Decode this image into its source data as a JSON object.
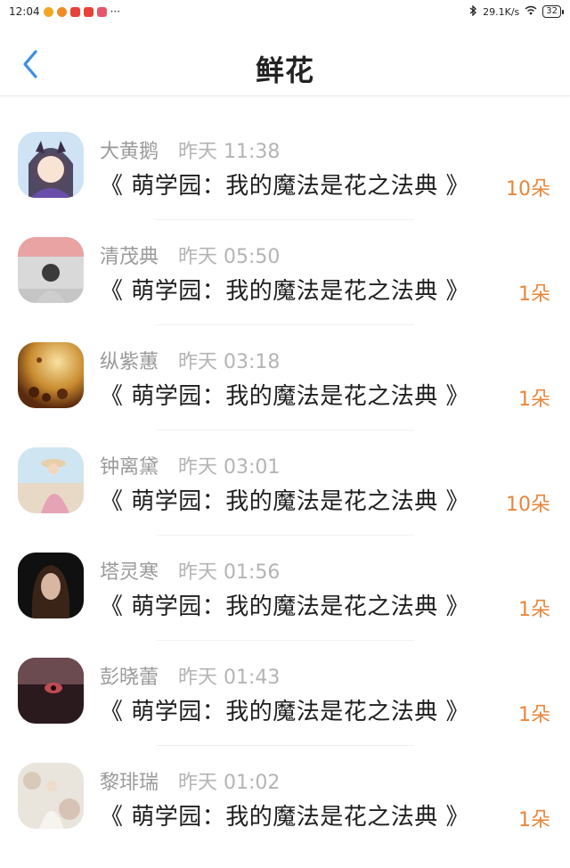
{
  "status_bar": {
    "time": "12:04",
    "dots": "···",
    "net_speed": "29.1K/s",
    "battery": "32"
  },
  "header": {
    "title": "鲜花"
  },
  "items": [
    {
      "name": "大黄鹅",
      "time": "昨天 11:38",
      "book": "《 萌学园：我的魔法是花之法典 》",
      "count": "10朵"
    },
    {
      "name": "清茂典",
      "time": "昨天 05:50",
      "book": "《 萌学园：我的魔法是花之法典 》",
      "count": "1朵"
    },
    {
      "name": "纵紫蕙",
      "time": "昨天 03:18",
      "book": "《 萌学园：我的魔法是花之法典 》",
      "count": "1朵"
    },
    {
      "name": "钟离黛",
      "time": "昨天 03:01",
      "book": "《 萌学园：我的魔法是花之法典 》",
      "count": "10朵"
    },
    {
      "name": "塔灵寒",
      "time": "昨天 01:56",
      "book": "《 萌学园：我的魔法是花之法典 》",
      "count": "1朵"
    },
    {
      "name": "彭晓蕾",
      "time": "昨天 01:43",
      "book": "《 萌学园：我的魔法是花之法典 》",
      "count": "1朵"
    },
    {
      "name": "黎琲瑞",
      "time": "昨天 01:02",
      "book": "《 萌学园：我的魔法是花之法典 》",
      "count": "1朵"
    }
  ],
  "colors": {
    "accent": "#e8863a",
    "back_arrow": "#3a8ee6"
  }
}
